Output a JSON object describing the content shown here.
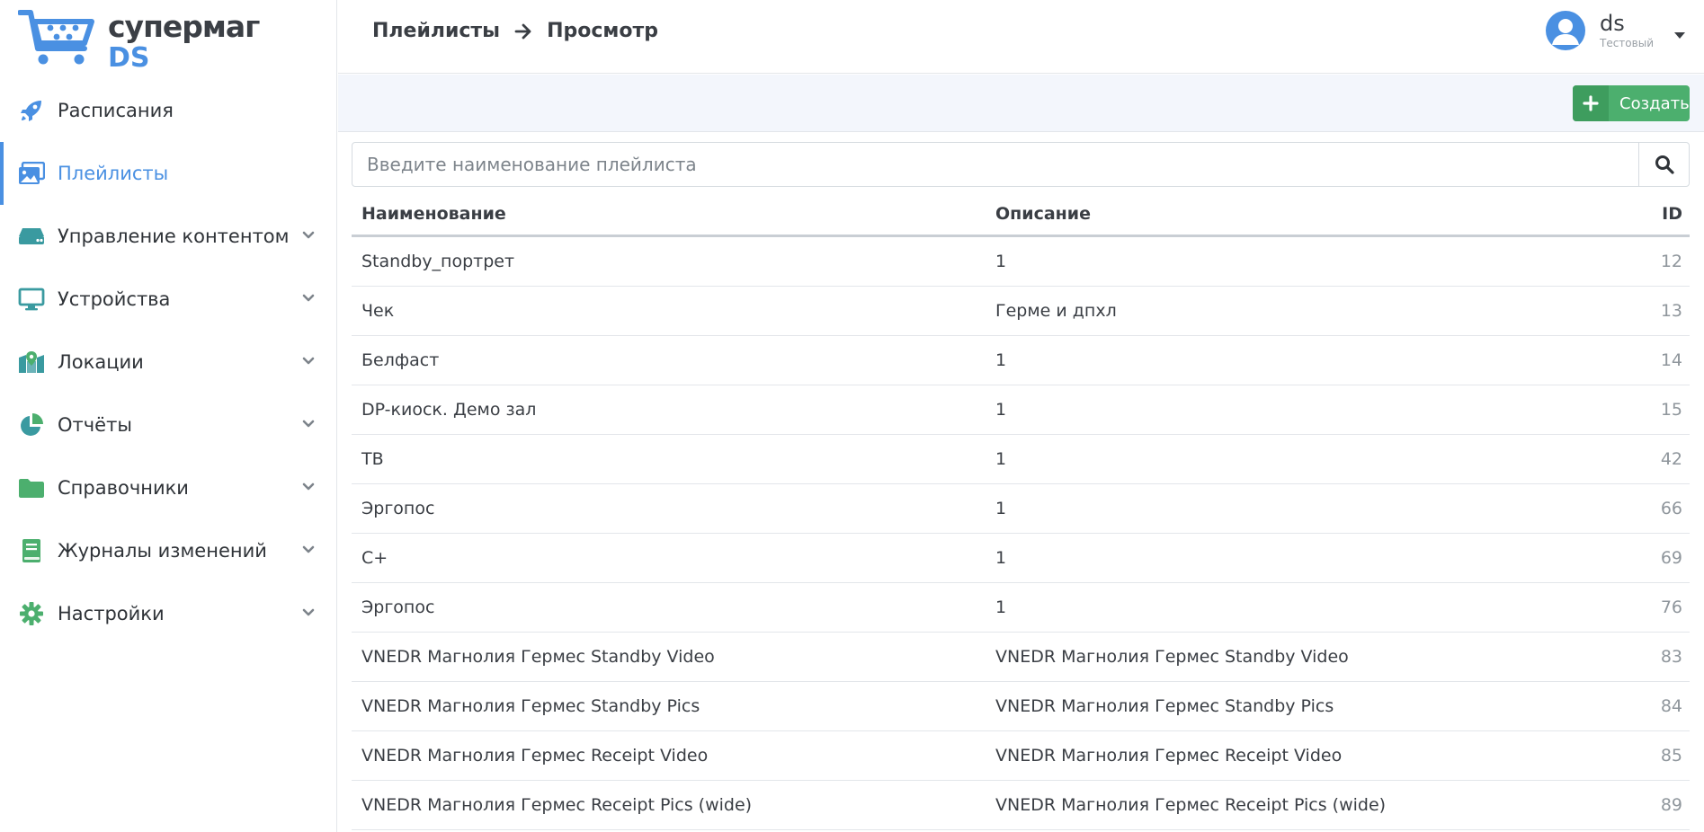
{
  "logo": {
    "word": "супермаг",
    "sub": "DS"
  },
  "sidebar": {
    "items": [
      {
        "label": "Расписания",
        "icon": "rocket-icon",
        "expandable": false,
        "active": false
      },
      {
        "label": "Плейлисты",
        "icon": "images-icon",
        "expandable": false,
        "active": true
      },
      {
        "label": "Управление контентом",
        "icon": "hdd-icon",
        "expandable": true,
        "active": false
      },
      {
        "label": "Устройства",
        "icon": "monitor-icon",
        "expandable": true,
        "active": false
      },
      {
        "label": "Локации",
        "icon": "map-marker-icon",
        "expandable": true,
        "active": false
      },
      {
        "label": "Отчёты",
        "icon": "pie-chart-icon",
        "expandable": true,
        "active": false
      },
      {
        "label": "Справочники",
        "icon": "folder-icon",
        "expandable": true,
        "active": false
      },
      {
        "label": "Журналы изменений",
        "icon": "book-icon",
        "expandable": true,
        "active": false
      },
      {
        "label": "Настройки",
        "icon": "gear-icon",
        "expandable": true,
        "active": false
      }
    ]
  },
  "header": {
    "breadcrumb": [
      "Плейлисты",
      "Просмотр"
    ],
    "user": {
      "name": "ds",
      "role": "Тестовый"
    }
  },
  "toolbar": {
    "create_label": "Создать"
  },
  "search": {
    "placeholder": "Введите наименование плейлиста",
    "value": ""
  },
  "table": {
    "columns": {
      "name": "Наименование",
      "description": "Описание",
      "id": "ID"
    },
    "rows": [
      {
        "name": "Standby_портрет",
        "description": "1",
        "id": "12"
      },
      {
        "name": "Чек",
        "description": "Герме и дпхл",
        "id": "13"
      },
      {
        "name": "Белфаст",
        "description": "1",
        "id": "14"
      },
      {
        "name": "DP-киоск. Демо зал",
        "description": "1",
        "id": "15"
      },
      {
        "name": "ТВ",
        "description": "1",
        "id": "42"
      },
      {
        "name": "Эргопос",
        "description": "1",
        "id": "66"
      },
      {
        "name": "C+",
        "description": "1",
        "id": "69"
      },
      {
        "name": "Эргопос",
        "description": "1",
        "id": "76"
      },
      {
        "name": "VNEDR Магнолия Гермес Standby Video",
        "description": "VNEDR Магнолия Гермес Standby Video",
        "id": "83"
      },
      {
        "name": "VNEDR Магнолия Гермес Standby Pics",
        "description": "VNEDR Магнолия Гермес Standby Pics",
        "id": "84"
      },
      {
        "name": "VNEDR Магнолия Гермес Receipt Video",
        "description": "VNEDR Магнолия Гермес Receipt Video",
        "id": "85"
      },
      {
        "name": "VNEDR Магнолия Гермес Receipt Pics (wide)",
        "description": "VNEDR Магнолия Гермес Receipt Pics (wide)",
        "id": "89"
      }
    ]
  },
  "colors": {
    "accent": "#4a90e2",
    "success": "#4caf6e",
    "icon_teal": "#3aa0a0",
    "toolbar_bg": "#f3f6fc"
  }
}
